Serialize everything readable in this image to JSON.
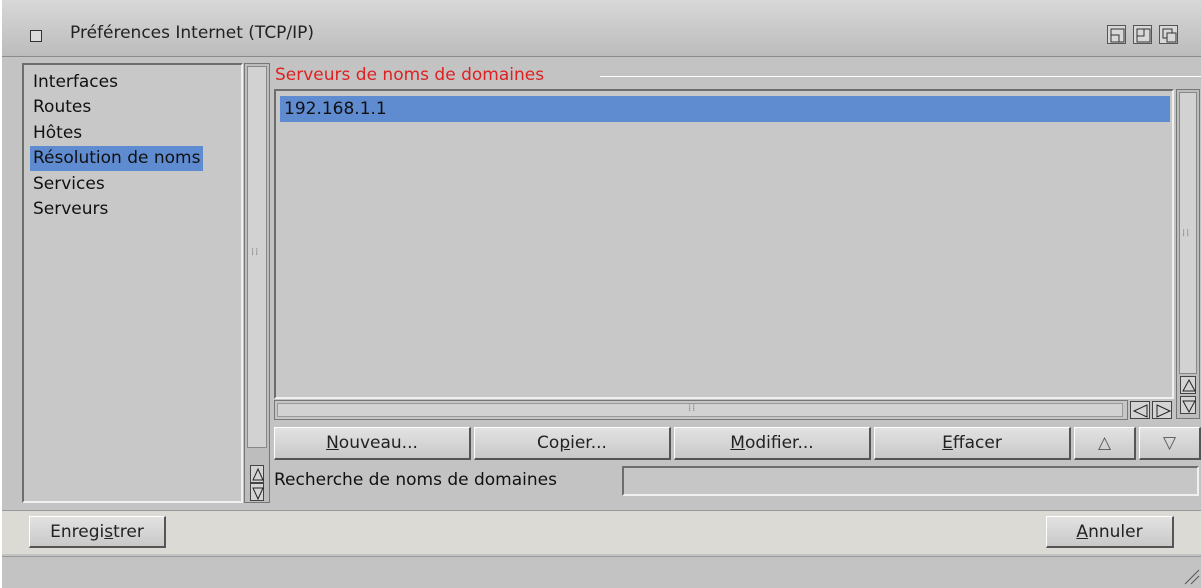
{
  "window": {
    "title": "Préférences Internet (TCP/IP)"
  },
  "sidebar": {
    "items": [
      {
        "label": "Interfaces",
        "selected": false
      },
      {
        "label": "Routes",
        "selected": false
      },
      {
        "label": "Hôtes",
        "selected": false
      },
      {
        "label": "Résolution de noms",
        "selected": true
      },
      {
        "label": "Services",
        "selected": false
      },
      {
        "label": "Serveurs",
        "selected": false
      }
    ]
  },
  "dns": {
    "group_label": "Serveurs de noms de domaines",
    "servers": [
      "192.168.1.1"
    ],
    "buttons": {
      "new_u": "N",
      "new_rest": "ouveau...",
      "copy_a": "Co",
      "copy_u": "p",
      "copy_rest": "ier...",
      "modify_u": "M",
      "modify_rest": "odifier...",
      "delete_u": "E",
      "delete_rest": "ffacer",
      "up": "△",
      "down": "▽"
    },
    "search_label": "Recherche de noms de domaines",
    "search_value": ""
  },
  "footer": {
    "save_a": "Enregi",
    "save_u": "s",
    "save_rest": "trer",
    "cancel_u": "A",
    "cancel_rest": "nnuler"
  },
  "colors": {
    "selection": "#5f8bd0",
    "group_label": "#e02020",
    "window_bg": "#c3c3c3"
  }
}
